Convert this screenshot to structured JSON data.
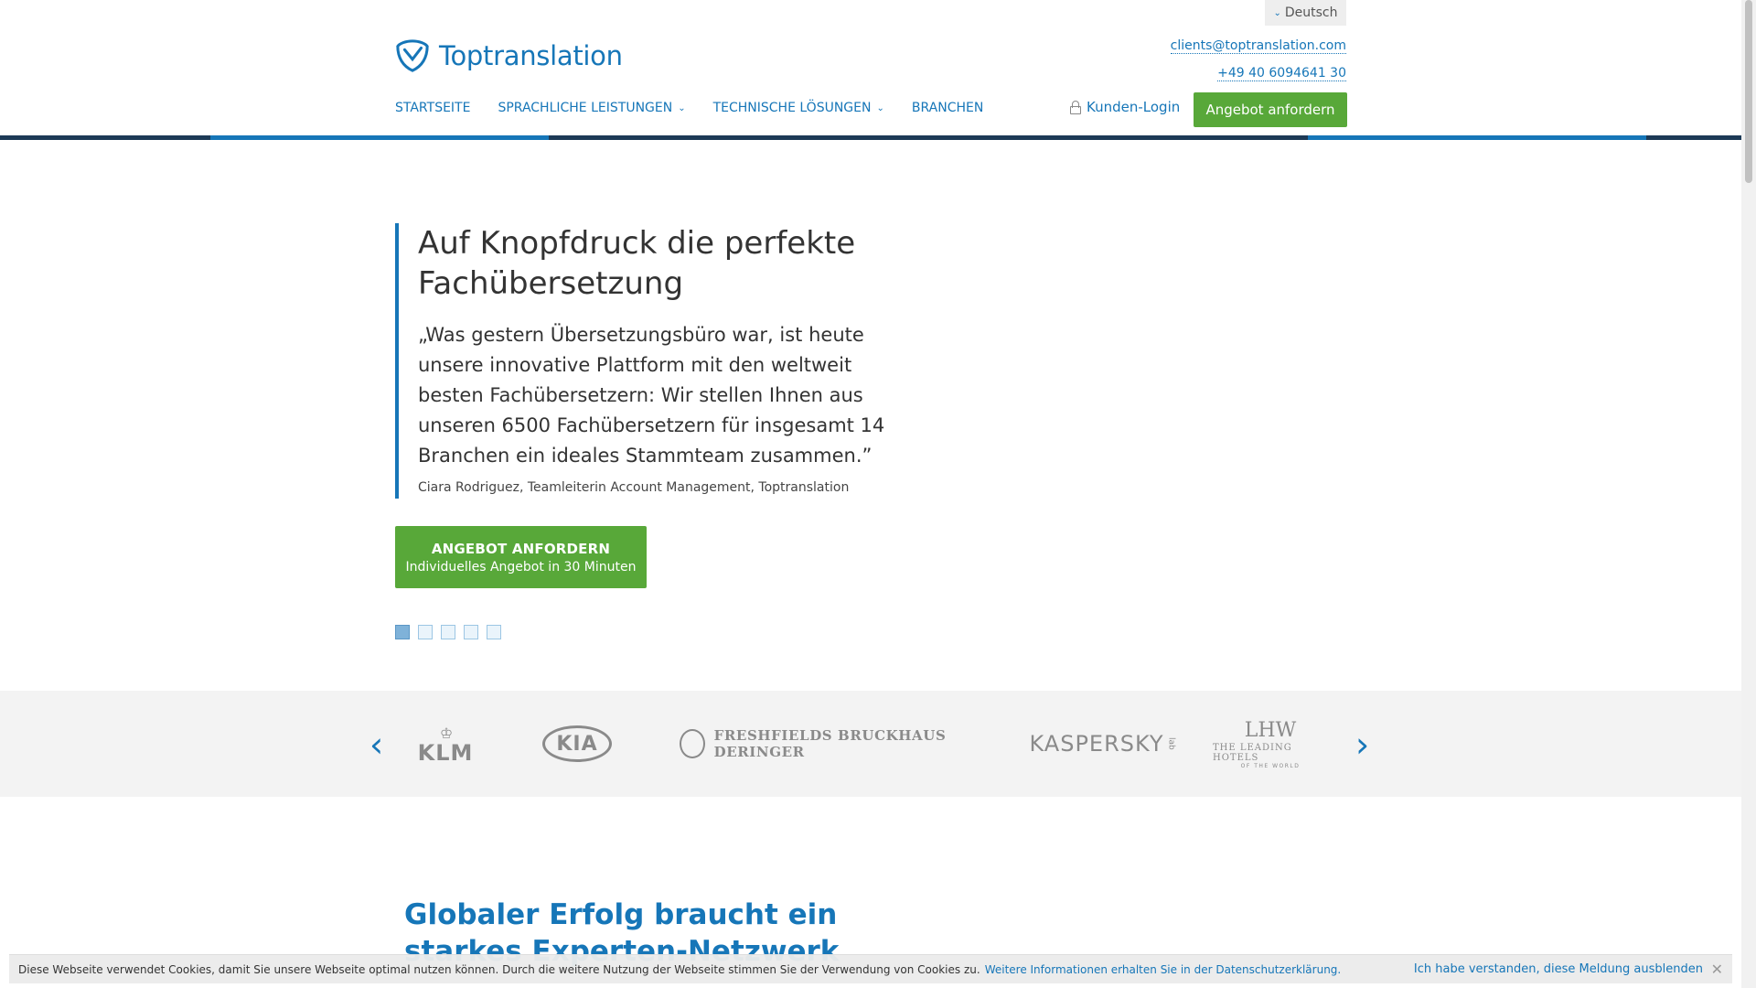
{
  "header": {
    "language": "Deutsch",
    "logo_text": "Toptranslation",
    "email": "clients@toptranslation.com",
    "phone": "+49 40 6094641 30"
  },
  "nav": {
    "items": [
      {
        "label": "STARTSEITE"
      },
      {
        "label": "SPRACHLICHE LEISTUNGEN"
      },
      {
        "label": "TECHNISCHE LÖSUNGEN"
      },
      {
        "label": "BRANCHEN"
      }
    ],
    "login": "Kunden-Login",
    "cta": "Angebot anfordern"
  },
  "hero": {
    "title": "Auf Knopfdruck die perfekte Fachübersetzung",
    "quote": "„Was gestern Übersetzungsbüro war, ist heute unsere innovative Plattform mit den weltweit besten Fachübersetzern: Wir stellen Ihnen aus unseren 6500 Fachübersetzern für insgesamt 14 Branchen ein ideales Stammteam zusammen.”",
    "author": "Ciara Rodriguez, Teamleiterin Account Management, Toptranslation",
    "cta_line1": "ANGEBOT ANFORDERN",
    "cta_line2": "Individuelles Angebot in 30 Minuten",
    "slides_total": 5,
    "slide_active": 1
  },
  "clients": {
    "klm": "KLM",
    "kia": "KIA",
    "freshfields": "FRESHFIELDS BRUCKHAUS DERINGER",
    "kaspersky": "KASPERSKY",
    "kaspersky_lab": "lab",
    "lhw_mono": "LHW",
    "lhw": "THE LEADING HOTELS",
    "lhw_sub": "OF THE WORLD"
  },
  "section": {
    "title": "Globaler Erfolg braucht ein starkes Experten-Netzwerk"
  },
  "cookie": {
    "text": "Diese Webseite verwendet Cookies, damit Sie unsere Webseite optimal nutzen können. Durch die weitere Nutzung der Webseite stimmen Sie der Verwendung von Cookies zu.",
    "link": "Weitere Informationen erhalten Sie in der Datenschutzerklärung.",
    "dismiss": "Ich habe verstanden, diese Meldung ausblenden"
  },
  "colors": {
    "brand_blue": "#1676b8",
    "cta_green": "#58a839",
    "dark_stripe": "#1d3a56"
  }
}
